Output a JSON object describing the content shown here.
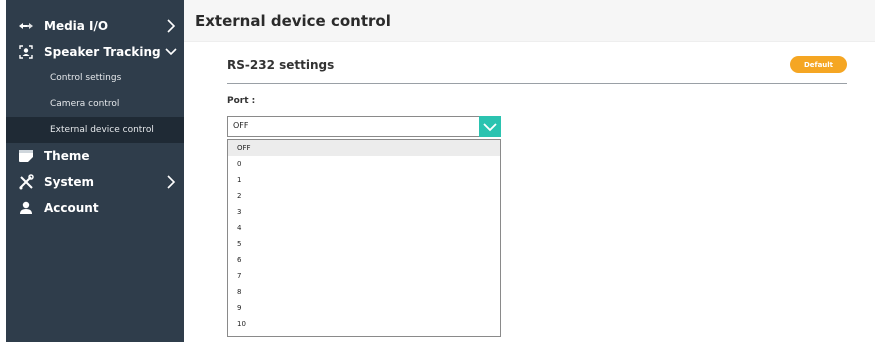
{
  "sidebar": {
    "items": [
      {
        "label": "Media I/O",
        "icon": "media-io-icon",
        "chevron": "chevron-right-icon"
      },
      {
        "label": "Speaker Tracking",
        "icon": "speaker-tracking-icon",
        "chevron": "chevron-down-icon"
      },
      {
        "label": "Theme",
        "icon": "theme-icon"
      },
      {
        "label": "System",
        "icon": "system-tools-icon",
        "chevron": "chevron-right-icon"
      },
      {
        "label": "Account",
        "icon": "user-icon"
      }
    ],
    "subitems": [
      {
        "label": "Control settings"
      },
      {
        "label": "Camera control"
      },
      {
        "label": "External device control",
        "active": true
      }
    ]
  },
  "main": {
    "title": "External device control",
    "section": {
      "title": "RS-232 settings",
      "default_button": "Default"
    },
    "port": {
      "label": "Port :",
      "selected": "OFF",
      "options": [
        "OFF",
        "0",
        "1",
        "2",
        "3",
        "4",
        "5",
        "6",
        "7",
        "8",
        "9",
        "10"
      ]
    }
  },
  "colors": {
    "sidebar_bg": "#2f3d4b",
    "sidebar_active": "#1f2a35",
    "accent_orange": "#f5a623",
    "accent_teal": "#2bc3b0"
  }
}
